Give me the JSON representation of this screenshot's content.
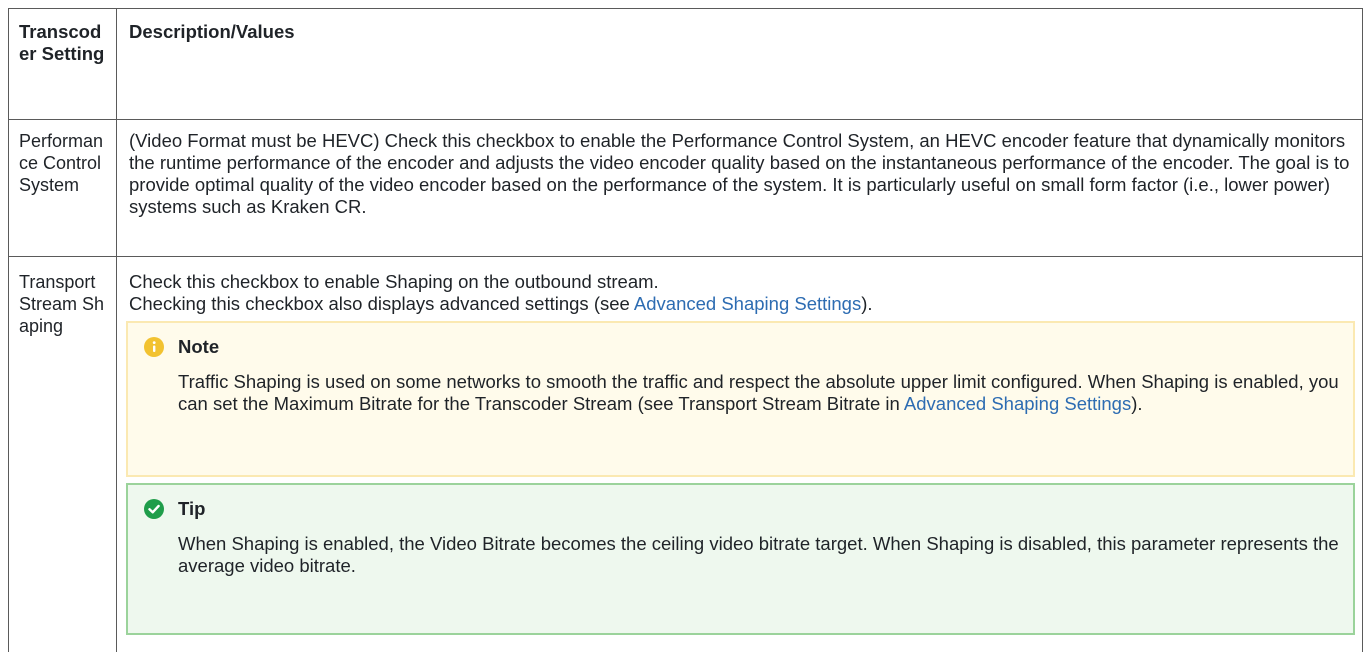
{
  "table": {
    "header": {
      "col1": "Transcoder Setting",
      "col2": "Description/Values"
    },
    "rows": [
      {
        "setting": "Performance Control System",
        "description": "(Video Format must be HEVC) Check this checkbox to enable the Performance Control System, an HEVC encoder feature that dynamically monitors the runtime performance of the encoder and adjusts the video encoder quality based on the instantaneous performance of the encoder. The goal is to provide optimal quality of the video encoder based on the performance of the system. It is particularly useful on small form factor (i.e., lower power) systems such as Kraken CR."
      },
      {
        "setting": "Transport Stream Shaping",
        "line1": "Check this checkbox to enable Shaping on the outbound stream.",
        "line2_pre": "Checking this checkbox also displays advanced settings (see ",
        "line2_link": "Advanced Shaping Settings",
        "line2_post": ").",
        "note": {
          "title": "Note",
          "icon": "info-circle-icon",
          "body_pre": "Traffic Shaping is used on some networks to smooth the traffic and respect the absolute upper limit configured. When Shaping is enabled, you can set the Maximum Bitrate for the Transcoder Stream (see Transport Stream Bitrate in ",
          "body_link": "Advanced Shaping Settings",
          "body_post": ")."
        },
        "tip": {
          "title": "Tip",
          "icon": "check-circle-icon",
          "body": "When Shaping is enabled, the Video Bitrate becomes the ceiling video bitrate target. When Shaping is disabled, this parameter represents the average video bitrate."
        }
      }
    ]
  },
  "colors": {
    "link": "#2d6cb2",
    "note_bg": "#fffbeb",
    "note_border": "#fbe9b2",
    "note_icon": "#f2c230",
    "tip_bg": "#eef8ee",
    "tip_border": "#9bd39b",
    "tip_icon": "#1f9d4a"
  }
}
